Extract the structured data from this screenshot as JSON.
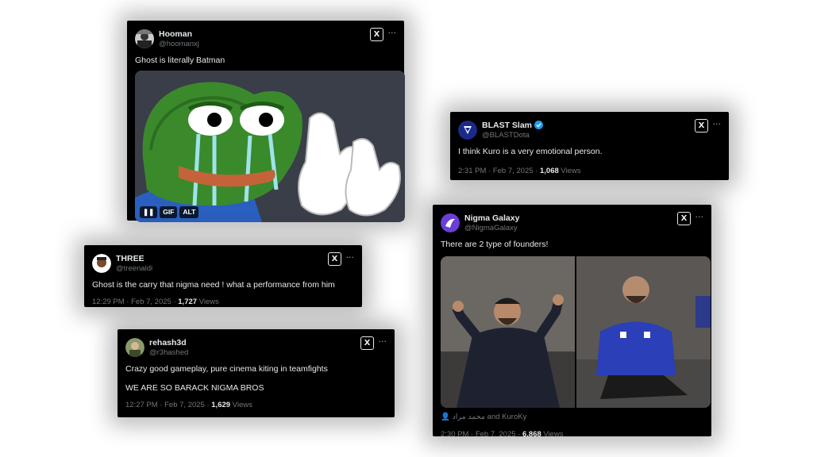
{
  "tweets": {
    "hooman": {
      "name": "Hooman",
      "handle": "@hoomanxj",
      "text": "Ghost is literally Batman",
      "media": {
        "pause": "❚❚",
        "gif": "GIF",
        "alt": "ALT"
      }
    },
    "blast": {
      "name": "BLAST Slam",
      "handle": "@BLASTDota",
      "text": "I think Kuro is a very emotional person.",
      "meta_time": "2:31 PM · Feb 7, 2025 · ",
      "views_count": "1,068",
      "views_label": " Views"
    },
    "three": {
      "name": "THREE",
      "handle": "@treenaldi",
      "text": "Ghost is the carry that nigma need ! what a performance from him",
      "meta_time": "12:29 PM · Feb 7, 2025 · ",
      "views_count": "1,727",
      "views_label": " Views"
    },
    "rehash": {
      "name": "rehash3d",
      "handle": "@r3hashed",
      "text1": "Crazy good gameplay, pure cinema kiting in teamfights",
      "text2": "WE ARE SO BARACK NIGMA BROS",
      "meta_time": "12:27 PM · Feb 7, 2025 · ",
      "views_count": "1,629",
      "views_label": " Views"
    },
    "nigma": {
      "name": "Nigma Galaxy",
      "handle": "@NigmaGalaxy",
      "text": "There are 2 type of founders!",
      "tagged": "محمد مراد and KuroKy",
      "meta_time": "2:30 PM · Feb 7, 2025 · ",
      "views_count": "6,868",
      "views_label": " Views"
    }
  },
  "icons": {
    "x_logo": "X",
    "more": "···",
    "verified_color": "#1d9bf0"
  },
  "colors": {
    "card_bg": "#000000",
    "text": "#e7e9ea",
    "muted": "#71767b",
    "page_bg": "#ffffff"
  }
}
